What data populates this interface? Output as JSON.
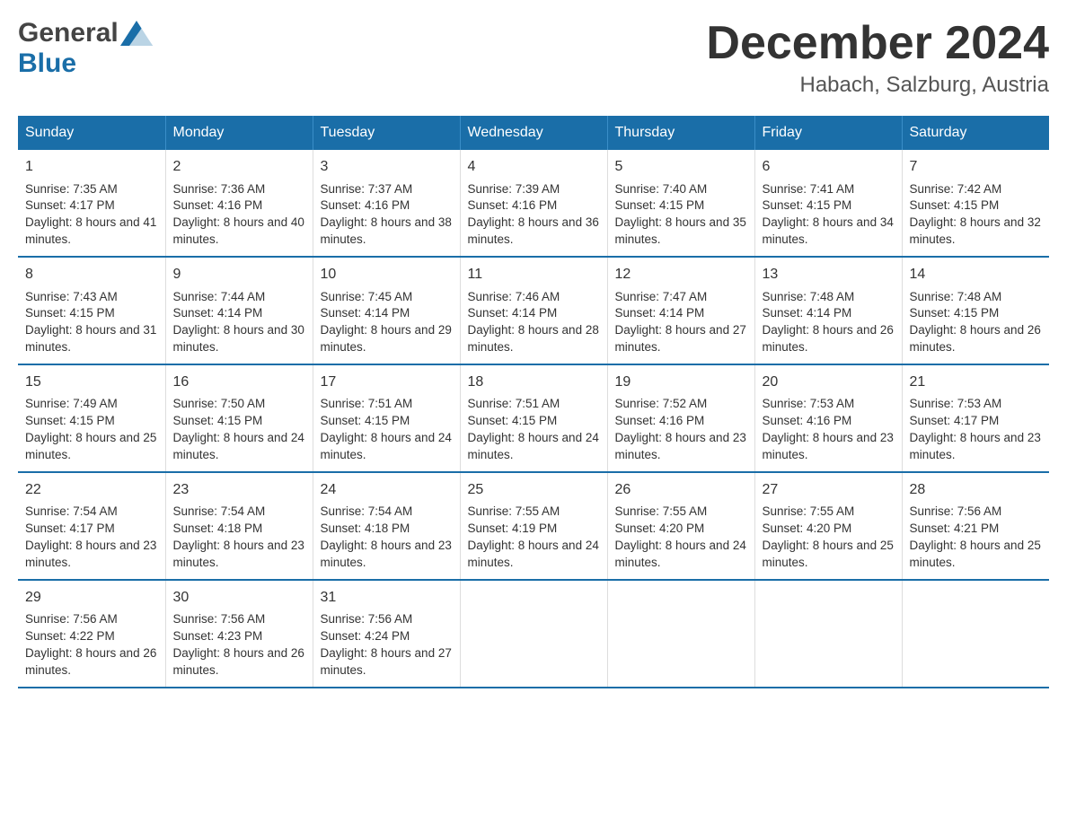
{
  "logo": {
    "general": "General",
    "blue": "Blue"
  },
  "title": "December 2024",
  "subtitle": "Habach, Salzburg, Austria",
  "days_of_week": [
    "Sunday",
    "Monday",
    "Tuesday",
    "Wednesday",
    "Thursday",
    "Friday",
    "Saturday"
  ],
  "weeks": [
    [
      {
        "day": "1",
        "sunrise": "7:35 AM",
        "sunset": "4:17 PM",
        "daylight": "8 hours and 41 minutes."
      },
      {
        "day": "2",
        "sunrise": "7:36 AM",
        "sunset": "4:16 PM",
        "daylight": "8 hours and 40 minutes."
      },
      {
        "day": "3",
        "sunrise": "7:37 AM",
        "sunset": "4:16 PM",
        "daylight": "8 hours and 38 minutes."
      },
      {
        "day": "4",
        "sunrise": "7:39 AM",
        "sunset": "4:16 PM",
        "daylight": "8 hours and 36 minutes."
      },
      {
        "day": "5",
        "sunrise": "7:40 AM",
        "sunset": "4:15 PM",
        "daylight": "8 hours and 35 minutes."
      },
      {
        "day": "6",
        "sunrise": "7:41 AM",
        "sunset": "4:15 PM",
        "daylight": "8 hours and 34 minutes."
      },
      {
        "day": "7",
        "sunrise": "7:42 AM",
        "sunset": "4:15 PM",
        "daylight": "8 hours and 32 minutes."
      }
    ],
    [
      {
        "day": "8",
        "sunrise": "7:43 AM",
        "sunset": "4:15 PM",
        "daylight": "8 hours and 31 minutes."
      },
      {
        "day": "9",
        "sunrise": "7:44 AM",
        "sunset": "4:14 PM",
        "daylight": "8 hours and 30 minutes."
      },
      {
        "day": "10",
        "sunrise": "7:45 AM",
        "sunset": "4:14 PM",
        "daylight": "8 hours and 29 minutes."
      },
      {
        "day": "11",
        "sunrise": "7:46 AM",
        "sunset": "4:14 PM",
        "daylight": "8 hours and 28 minutes."
      },
      {
        "day": "12",
        "sunrise": "7:47 AM",
        "sunset": "4:14 PM",
        "daylight": "8 hours and 27 minutes."
      },
      {
        "day": "13",
        "sunrise": "7:48 AM",
        "sunset": "4:14 PM",
        "daylight": "8 hours and 26 minutes."
      },
      {
        "day": "14",
        "sunrise": "7:48 AM",
        "sunset": "4:15 PM",
        "daylight": "8 hours and 26 minutes."
      }
    ],
    [
      {
        "day": "15",
        "sunrise": "7:49 AM",
        "sunset": "4:15 PM",
        "daylight": "8 hours and 25 minutes."
      },
      {
        "day": "16",
        "sunrise": "7:50 AM",
        "sunset": "4:15 PM",
        "daylight": "8 hours and 24 minutes."
      },
      {
        "day": "17",
        "sunrise": "7:51 AM",
        "sunset": "4:15 PM",
        "daylight": "8 hours and 24 minutes."
      },
      {
        "day": "18",
        "sunrise": "7:51 AM",
        "sunset": "4:15 PM",
        "daylight": "8 hours and 24 minutes."
      },
      {
        "day": "19",
        "sunrise": "7:52 AM",
        "sunset": "4:16 PM",
        "daylight": "8 hours and 23 minutes."
      },
      {
        "day": "20",
        "sunrise": "7:53 AM",
        "sunset": "4:16 PM",
        "daylight": "8 hours and 23 minutes."
      },
      {
        "day": "21",
        "sunrise": "7:53 AM",
        "sunset": "4:17 PM",
        "daylight": "8 hours and 23 minutes."
      }
    ],
    [
      {
        "day": "22",
        "sunrise": "7:54 AM",
        "sunset": "4:17 PM",
        "daylight": "8 hours and 23 minutes."
      },
      {
        "day": "23",
        "sunrise": "7:54 AM",
        "sunset": "4:18 PM",
        "daylight": "8 hours and 23 minutes."
      },
      {
        "day": "24",
        "sunrise": "7:54 AM",
        "sunset": "4:18 PM",
        "daylight": "8 hours and 23 minutes."
      },
      {
        "day": "25",
        "sunrise": "7:55 AM",
        "sunset": "4:19 PM",
        "daylight": "8 hours and 24 minutes."
      },
      {
        "day": "26",
        "sunrise": "7:55 AM",
        "sunset": "4:20 PM",
        "daylight": "8 hours and 24 minutes."
      },
      {
        "day": "27",
        "sunrise": "7:55 AM",
        "sunset": "4:20 PM",
        "daylight": "8 hours and 25 minutes."
      },
      {
        "day": "28",
        "sunrise": "7:56 AM",
        "sunset": "4:21 PM",
        "daylight": "8 hours and 25 minutes."
      }
    ],
    [
      {
        "day": "29",
        "sunrise": "7:56 AM",
        "sunset": "4:22 PM",
        "daylight": "8 hours and 26 minutes."
      },
      {
        "day": "30",
        "sunrise": "7:56 AM",
        "sunset": "4:23 PM",
        "daylight": "8 hours and 26 minutes."
      },
      {
        "day": "31",
        "sunrise": "7:56 AM",
        "sunset": "4:24 PM",
        "daylight": "8 hours and 27 minutes."
      },
      null,
      null,
      null,
      null
    ]
  ],
  "labels": {
    "sunrise_prefix": "Sunrise: ",
    "sunset_prefix": "Sunset: ",
    "daylight_prefix": "Daylight: "
  },
  "colors": {
    "header_bg": "#1a6ea8",
    "header_text": "#ffffff",
    "border": "#1a6ea8",
    "cell_border": "#ddd"
  }
}
